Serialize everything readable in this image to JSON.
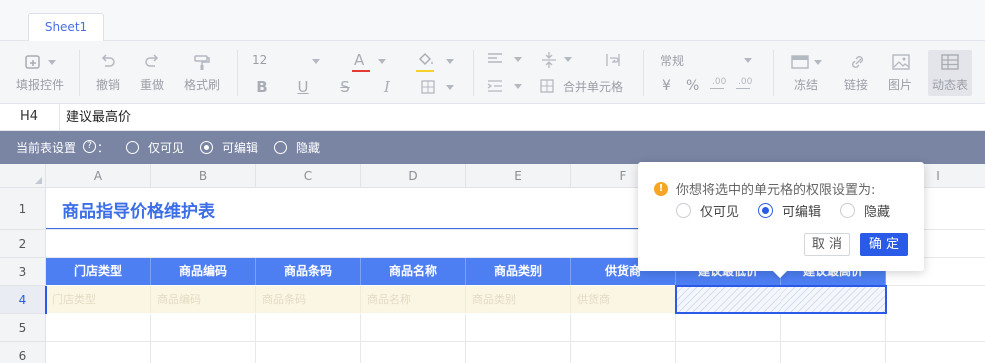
{
  "sheet_tab": "Sheet1",
  "toolbar": {
    "fill_report_control": "填报控件",
    "undo": "撤销",
    "redo": "重做",
    "format_painter": "格式刷",
    "font_size": "12",
    "font_color_letter": "A",
    "bold": "B",
    "underline": "U",
    "strikethrough": "S",
    "italic": "I",
    "merge_cells": "合并单元格",
    "number_format": "常规",
    "currency": "¥",
    "percent": "%",
    "decimal_increase": ".00",
    "decimal_decrease": ".00",
    "freeze": "冻结",
    "link": "链接",
    "image": "图片",
    "dynamic_table": "动态表",
    "font_color": "#e53935",
    "fill_color": "#f5d22b"
  },
  "formula_bar": {
    "cell_ref": "H4",
    "value": "建议最高价"
  },
  "settings_bar": {
    "label": "当前表设置",
    "colon": "：",
    "help": "?",
    "options": [
      "仅可见",
      "可编辑",
      "隐藏"
    ],
    "selected": "可编辑"
  },
  "grid": {
    "columns": [
      "A",
      "B",
      "C",
      "D",
      "E",
      "F",
      "G",
      "H",
      "I"
    ],
    "rows": [
      "1",
      "2",
      "3",
      "4",
      "5",
      "6"
    ],
    "title": "商品指导价格维护表",
    "headers": [
      "门店类型",
      "商品编码",
      "商品条码",
      "商品名称",
      "商品类别",
      "供货商",
      "建议最低价",
      "建议最高价"
    ],
    "row4": [
      "门店类型",
      "商品编码",
      "商品条码",
      "商品名称",
      "商品类别",
      "供货商",
      "",
      ""
    ],
    "header_color": "#4d7ef2",
    "title_color": "#3c6ee8"
  },
  "popup": {
    "message": "你想将选中的单元格的权限设置为:",
    "options": [
      "仅可见",
      "可编辑",
      "隐藏"
    ],
    "selected": "可编辑",
    "cancel": "取 消",
    "confirm": "确 定",
    "warn_icon": "!",
    "accent": "#2a5be8"
  }
}
